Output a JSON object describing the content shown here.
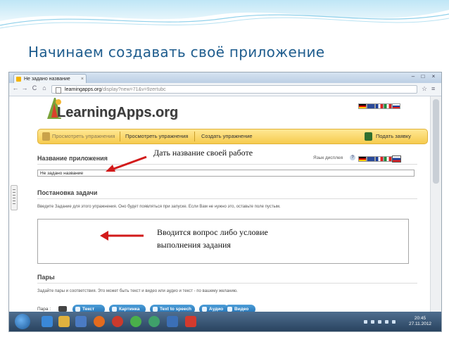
{
  "slide": {
    "title": "Начинаем  создавать  своё приложение"
  },
  "browser": {
    "tab_title": "Не задано название",
    "tab_close": "×",
    "window_controls": [
      "–",
      "□",
      "×"
    ],
    "nav": {
      "back": "←",
      "forward": "→",
      "reload": "C",
      "home": "⌂"
    },
    "url_host": "learningapps.org",
    "url_path": "/display?new=71&v=9zertubc",
    "toolbar_icons": {
      "star": "☆",
      "wrench": "≡"
    }
  },
  "page": {
    "logo_text": "LearningApps.org",
    "menu": {
      "search_placeholder": "Просмотреть упражнения",
      "view": "Просмотреть упражнения",
      "create": "Создать упражнение",
      "submit": "Подать заявку"
    },
    "language_label": "Язык дисплея",
    "language_help": "?",
    "app_name_heading": "Название приложения",
    "app_name_value": "Не задано название",
    "task_heading": "Постановка задачи",
    "task_hint": "Введите Задание для этого упражнения. Оно будет появляться при запуске. Если Вам не нужно это, оставьте поле пустым.",
    "pairs_heading": "Пары",
    "pairs_hint": "Задайте пары и соответствия. Это может быть текст и видео или аудио и текст - по вашему желанию.",
    "pairs_label": "Пара :",
    "pair_buttons": [
      "Текст",
      "Картинка",
      "Text to speech",
      "Аудио",
      "Видео"
    ]
  },
  "annotations": {
    "name_callout": "Дать название своей работе",
    "task_callout_line1": "Вводится  вопрос либо условие",
    "task_callout_line2": "выполнения задания"
  },
  "taskbar": {
    "clock_time": "20:45",
    "clock_date": "27.11.2012"
  }
}
